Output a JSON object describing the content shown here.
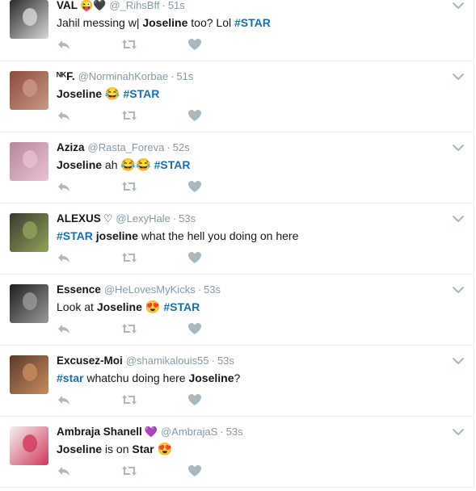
{
  "tweets": [
    {
      "name": "VAL",
      "name_emojis": "😜🖤",
      "handle": "@_RihsBff",
      "dot": "·",
      "time": "51s",
      "segments": [
        {
          "t": "Jahil messing w| ",
          "s": "plain"
        },
        {
          "t": "Joseline",
          "s": "bold"
        },
        {
          "t": " too? Lol ",
          "s": "plain"
        },
        {
          "t": "#STAR",
          "s": "tag"
        }
      ],
      "avatar": [
        "#2b2b2b",
        "#d8d8d8"
      ]
    },
    {
      "name": "ᴺᴷF.",
      "name_emojis": "",
      "handle": "@NorminahKorbae",
      "dot": "·",
      "time": "51s",
      "segments": [
        {
          "t": "Joseline",
          "s": "bold"
        },
        {
          "t": " ",
          "s": "plain"
        },
        {
          "t": "😂",
          "s": "emoji"
        },
        {
          "t": " ",
          "s": "plain"
        },
        {
          "t": "#STAR",
          "s": "tag"
        }
      ],
      "avatar": [
        "#8b4a3c",
        "#c99a86"
      ]
    },
    {
      "name": "Aziza",
      "name_emojis": "",
      "handle": "@Rasta_Foreva",
      "dot": "·",
      "time": "52s",
      "segments": [
        {
          "t": "Joseline",
          "s": "bold"
        },
        {
          "t": " ah ",
          "s": "plain"
        },
        {
          "t": "😂😂",
          "s": "emoji"
        },
        {
          "t": " ",
          "s": "plain"
        },
        {
          "t": "#STAR",
          "s": "tag"
        }
      ],
      "avatar": [
        "#b9869d",
        "#e8c1d2"
      ]
    },
    {
      "name": "ALEXUS",
      "name_emojis": "♡",
      "handle": "@LexyHale",
      "dot": "·",
      "time": "53s",
      "segments": [
        {
          "t": "#STAR",
          "s": "tag"
        },
        {
          "t": " ",
          "s": "plain"
        },
        {
          "t": "joseline",
          "s": "bold"
        },
        {
          "t": " what the hell you doing on here",
          "s": "plain"
        }
      ],
      "avatar": [
        "#3a3a2e",
        "#8fa45a"
      ]
    },
    {
      "name": "Essence",
      "name_emojis": "",
      "handle": "@HeLovesMyKicks",
      "dot": "·",
      "time": "53s",
      "segments": [
        {
          "t": "Look at ",
          "s": "plain"
        },
        {
          "t": "Joseline",
          "s": "bold"
        },
        {
          "t": " ",
          "s": "plain"
        },
        {
          "t": "😍",
          "s": "emoji"
        },
        {
          "t": " ",
          "s": "plain"
        },
        {
          "t": "#STAR",
          "s": "tag"
        }
      ],
      "avatar": [
        "#1e1e1e",
        "#9a9a9a"
      ]
    },
    {
      "name": "Excusez-Moi",
      "name_emojis": "",
      "handle": "@shamikalouis55",
      "dot": "·",
      "time": "53s",
      "segments": [
        {
          "t": "#star",
          "s": "tag"
        },
        {
          "t": " whatchu doing here ",
          "s": "plain"
        },
        {
          "t": "Joseline",
          "s": "bold"
        },
        {
          "t": "?",
          "s": "plain"
        }
      ],
      "avatar": [
        "#5b3a2a",
        "#c98c5e"
      ]
    },
    {
      "name": "Ambraja Shanell",
      "name_emojis": "💜",
      "handle": "@AmbrajaS",
      "dot": "·",
      "time": "53s",
      "segments": [
        {
          "t": "Joseline",
          "s": "bold"
        },
        {
          "t": " is on ",
          "s": "plain"
        },
        {
          "t": "Star",
          "s": "bold"
        },
        {
          "t": " ",
          "s": "plain"
        },
        {
          "t": "😍",
          "s": "emoji"
        }
      ],
      "avatar": [
        "#f2f2f2",
        "#d2375a"
      ]
    }
  ],
  "colors": {
    "name": "#14171a",
    "muted": "#8899a6",
    "hashtag": "#1b6eaa",
    "icon": "#aab8c2",
    "divider": "#e6ecf0"
  },
  "icons": {
    "reply": "reply-icon",
    "retweet": "retweet-icon",
    "like": "heart-icon",
    "more": "chevron-down-icon"
  }
}
